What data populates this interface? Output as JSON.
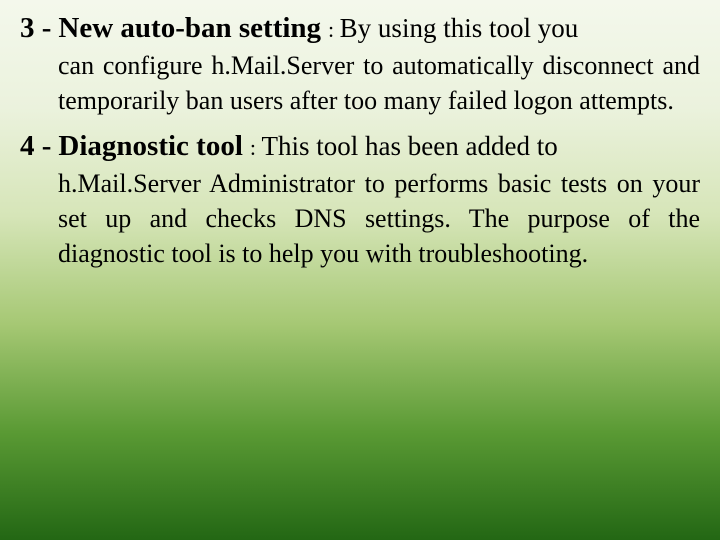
{
  "items": [
    {
      "number": "3 -",
      "title": "New auto-ban setting",
      "colon": " : ",
      "first_rest": "By using this tool you",
      "body": "can configure h.Mail.Server to automatically disconnect and temporarily ban users after too many failed logon attempts."
    },
    {
      "number": "4 -",
      "title": "Diagnostic tool",
      "colon": " : ",
      "first_rest": "This tool has been added to",
      "body": "h.Mail.Server Administrator to performs basic tests on your set up and checks DNS settings. The purpose of the diagnostic tool is to help you with troubleshooting."
    }
  ]
}
